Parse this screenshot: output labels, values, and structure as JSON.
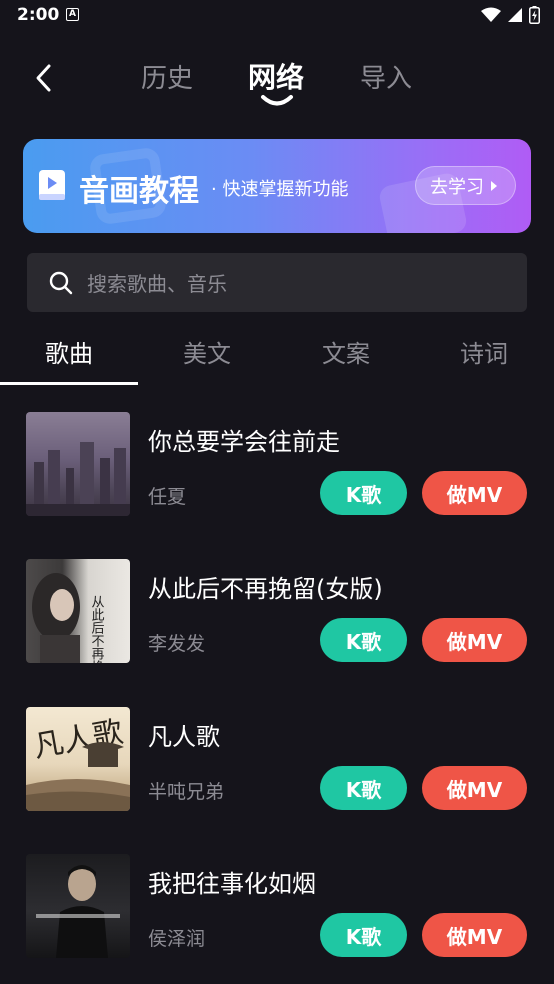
{
  "status": {
    "time": "2:00",
    "notif": "A"
  },
  "nav": {
    "tabs": [
      "历史",
      "网络",
      "导入"
    ],
    "active": "网络"
  },
  "banner": {
    "title": "音画教程",
    "subtitle": "· 快速掌握新功能",
    "button": "去学习"
  },
  "search": {
    "placeholder": "搜索歌曲、音乐"
  },
  "subtabs": [
    "歌曲",
    "美文",
    "文案",
    "诗词"
  ],
  "songs": [
    {
      "title": "你总要学会往前走",
      "artist": "任夏",
      "k_label": "K歌",
      "mv_label": "做MV"
    },
    {
      "title": "从此后不再挽留(女版)",
      "artist": "李发发",
      "k_label": "K歌",
      "mv_label": "做MV"
    },
    {
      "title": "凡人歌",
      "artist": "半吨兄弟",
      "k_label": "K歌",
      "mv_label": "做MV"
    },
    {
      "title": "我把往事化如烟",
      "artist": "侯泽润",
      "k_label": "K歌",
      "mv_label": "做MV"
    }
  ],
  "cover_texts": {
    "cover2": "从此后不再挽留",
    "cover3": "凡人歌"
  },
  "colors": {
    "background": "#15141b",
    "k_button": "#1fc7a3",
    "mv_button": "#ef5547",
    "search_bg": "#2a292f"
  }
}
